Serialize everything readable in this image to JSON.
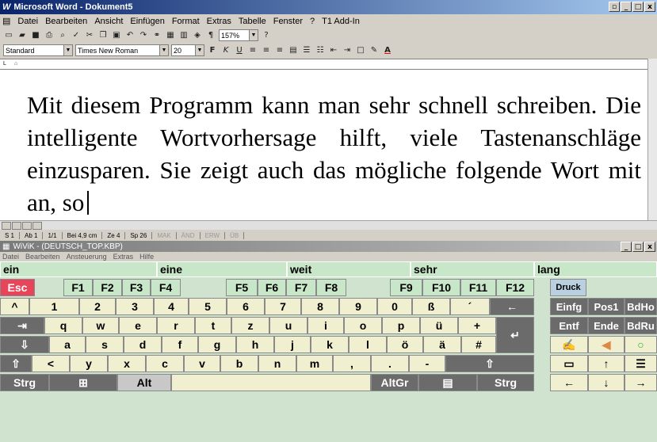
{
  "word": {
    "title": "Microsoft Word - Dokument5",
    "menu": [
      "Datei",
      "Bearbeiten",
      "Ansicht",
      "Einfügen",
      "Format",
      "Extras",
      "Tabelle",
      "Fenster",
      "?",
      "T1 Add-In"
    ],
    "style": "Standard",
    "font": "Times New Roman",
    "size": "20",
    "zoom": "157%",
    "document_text": "Mit diesem Programm kann man sehr schnell schreiben. Die intelligente Wortvorhersage hilft, viele Tastenanschläge einzusparen. Sie zeigt auch das mögliche folgende Wort mit an, so",
    "status": {
      "page": "S 1",
      "section": "Ab 1",
      "pages": "1/1",
      "pos": "Bei 4,9 cm",
      "line": "Ze 4",
      "col": "Sp 26",
      "mak": "MAK",
      "and": "ÄND",
      "erw": "ERW",
      "ub": "ÜB"
    }
  },
  "wivik": {
    "title": "WiViK - (DEUTSCH_TOP.KBP)",
    "menu": [
      "Datei",
      "Bearbeiten",
      "Ansteuerung",
      "Extras",
      "Hilfe"
    ],
    "predictions": [
      "ein",
      "eine",
      "weit",
      "sehr",
      "lang"
    ]
  },
  "keys": {
    "esc": "Esc",
    "f1": "F1",
    "f2": "F2",
    "f3": "F3",
    "f4": "F4",
    "f5": "F5",
    "f6": "F6",
    "f7": "F7",
    "f8": "F8",
    "f9": "F9",
    "f10": "F10",
    "f11": "F11",
    "f12": "F12",
    "druck": "Druck",
    "caret": "^",
    "k1": "1",
    "k2": "2",
    "k3": "3",
    "k4": "4",
    "k5": "5",
    "k6": "6",
    "k7": "7",
    "k8": "8",
    "k9": "9",
    "k0": "0",
    "sz": "ß",
    "acute": "´",
    "einfg": "Einfg",
    "pos1": "Pos1",
    "bdho": "BdHo",
    "q": "q",
    "w": "w",
    "e": "e",
    "r": "r",
    "t": "t",
    "z": "z",
    "u": "u",
    "i": "i",
    "o": "o",
    "p": "p",
    "ue": "ü",
    "plus": "+",
    "entf": "Entf",
    "ende": "Ende",
    "bdru": "BdRu",
    "a": "a",
    "s": "s",
    "d": "d",
    "f": "f",
    "g": "g",
    "h": "h",
    "j": "j",
    "k": "k",
    "l": "l",
    "oe": "ö",
    "ae": "ä",
    "hash": "#",
    "lt": "<",
    "y": "y",
    "x": "x",
    "c": "c",
    "v": "v",
    "b": "b",
    "n": "n",
    "m": "m",
    "comma": ",",
    "dot": ".",
    "minus": "-",
    "strg": "Strg",
    "alt": "Alt",
    "altgr": "AltGr",
    "strg2": "Strg"
  }
}
